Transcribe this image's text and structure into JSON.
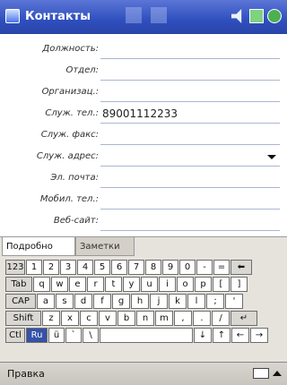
{
  "titlebar": {
    "title": "Контакты",
    "icons": [
      "speaker-icon",
      "battery-icon",
      "ok-icon"
    ]
  },
  "form": {
    "rows": [
      {
        "label": "Должность:",
        "value": ""
      },
      {
        "label": "Отдел:",
        "value": ""
      },
      {
        "label": "Организац.:",
        "value": ""
      },
      {
        "label": "Служ. тел.:",
        "value": "89001112233"
      },
      {
        "label": "Служ. факс:",
        "value": ""
      },
      {
        "label": "Служ. адрес:",
        "value": ""
      },
      {
        "label": "Эл. почта:",
        "value": ""
      },
      {
        "label": "Мобил. тел.:",
        "value": ""
      },
      {
        "label": "Веб-сайт:",
        "value": ""
      }
    ]
  },
  "tabs": [
    {
      "label": "Подробно",
      "active": true
    },
    {
      "label": "Заметки",
      "active": false
    }
  ],
  "keyboard": {
    "row1": [
      "123",
      "1",
      "2",
      "3",
      "4",
      "5",
      "6",
      "7",
      "8",
      "9",
      "0",
      "-",
      "=",
      "⬅"
    ],
    "row2": [
      "Tab",
      "q",
      "w",
      "e",
      "r",
      "t",
      "y",
      "u",
      "i",
      "o",
      "p",
      "[",
      "]"
    ],
    "row3": [
      "CAP",
      "a",
      "s",
      "d",
      "f",
      "g",
      "h",
      "j",
      "k",
      "l",
      ";",
      "'"
    ],
    "row4": [
      "Shift",
      "z",
      "x",
      "c",
      "v",
      "b",
      "n",
      "m",
      ",",
      ".",
      "/",
      "↵"
    ],
    "row5": [
      "Ctl",
      "Ru",
      "ü",
      "`",
      "\\",
      "",
      "↓",
      "↑",
      "←",
      "→"
    ]
  },
  "menubar": {
    "edit_label": "Правка"
  },
  "colors": {
    "titlebar": "#2f4fbe",
    "selected_key": "#3552a8"
  }
}
